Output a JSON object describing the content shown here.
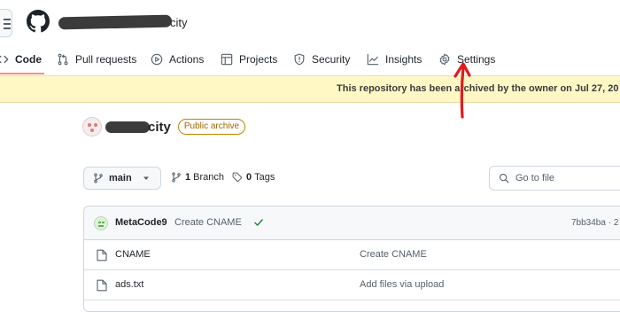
{
  "header": {
    "repo_name_suffix": "city"
  },
  "nav": {
    "tabs": [
      {
        "label": "Code",
        "icon": "code-icon"
      },
      {
        "label": "Pull requests",
        "icon": "pull-request-icon"
      },
      {
        "label": "Actions",
        "icon": "play-icon"
      },
      {
        "label": "Projects",
        "icon": "table-icon"
      },
      {
        "label": "Security",
        "icon": "shield-icon"
      },
      {
        "label": "Insights",
        "icon": "graph-icon"
      },
      {
        "label": "Settings",
        "icon": "gear-icon"
      }
    ],
    "active": "Code"
  },
  "banner": {
    "text": "This repository has been archived by the owner on Jul 27, 20"
  },
  "repo": {
    "name_suffix": "city",
    "badge": "Public archive"
  },
  "branch": {
    "current": "main",
    "branch_count": "1",
    "branch_label": "Branch",
    "tag_count": "0",
    "tag_label": "Tags"
  },
  "search": {
    "placeholder": "Go to file"
  },
  "commit": {
    "author": "MetaCode9",
    "message": "Create CNAME",
    "hash": "7bb34ba · 2"
  },
  "files": [
    {
      "name": "CNAME",
      "message": "Create CNAME"
    },
    {
      "name": "ads.txt",
      "message": "Add files via upload"
    }
  ],
  "colors": {
    "banner_bg": "#fff8c5",
    "active_underline": "#fd8c73",
    "annotation_arrow": "#e01b1b",
    "badge_border": "#bf8700",
    "check_green": "#1a7f37"
  }
}
